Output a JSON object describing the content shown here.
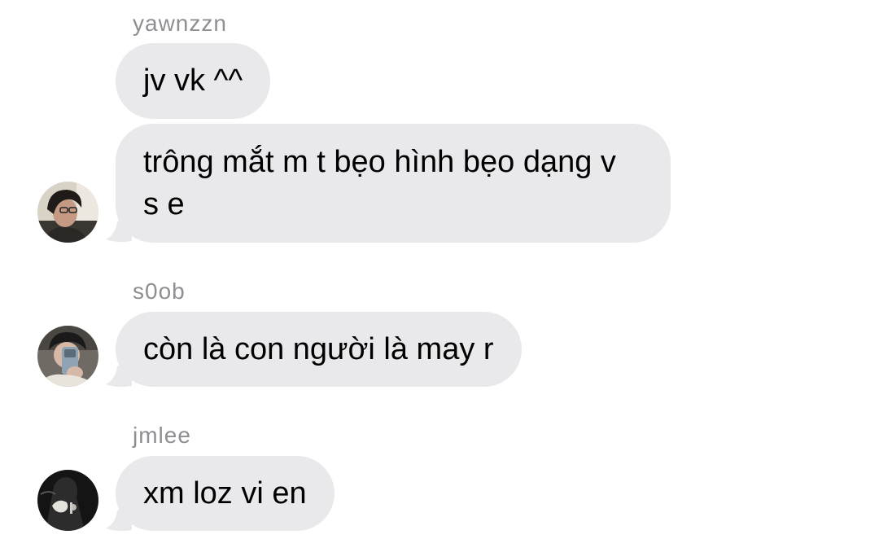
{
  "colors": {
    "background": "#ffffff",
    "bubble": "#e9e9eb",
    "sender_name": "#8e8e93",
    "message_text": "#000000"
  },
  "groups": [
    {
      "sender": "yawnzzn",
      "avatar_icon": "user-avatar-icon",
      "messages": [
        "jv vk ^^",
        "trông mắt m t bẹo hình bẹo dạng v s e"
      ]
    },
    {
      "sender": "s0ob",
      "avatar_icon": "user-avatar-icon",
      "messages": [
        "còn là con người là may r"
      ]
    },
    {
      "sender": "jmlee",
      "avatar_icon": "user-avatar-icon",
      "messages": [
        "xm loz vi en"
      ]
    }
  ]
}
